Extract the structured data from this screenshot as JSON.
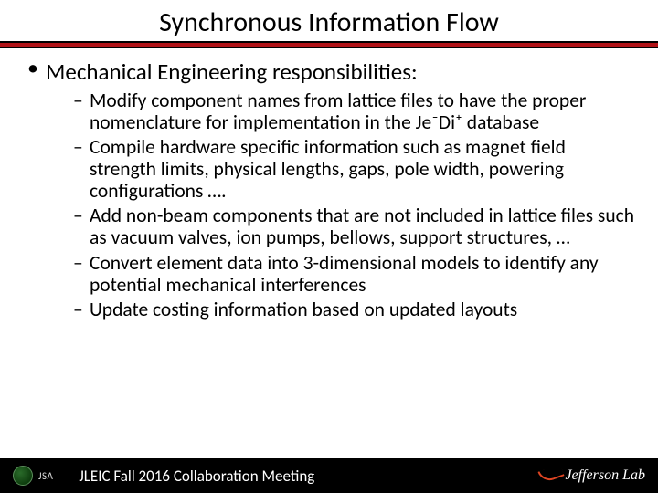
{
  "title": "Synchronous Information Flow",
  "bullet_main": "Mechanical Engineering responsibilities:",
  "sub_bullets": [
    "Modify component names from lattice files to have the proper nomenclature for implementation in the Je⁻Di⁺ database",
    "Compile hardware specific information such as magnet field strength limits, physical lengths, gaps, pole width, powering configurations ….",
    "Add non-beam components that are not included in lattice files such as vacuum valves, ion pumps, bellows, support structures, …",
    "Convert element data into 3-dimensional models to identify any potential mechanical interferences",
    "Update costing information based on updated layouts"
  ],
  "footer": {
    "jsa": "JSA",
    "meeting": "JLEIC Fall 2016 Collaboration Meeting",
    "lab": "Jefferson Lab"
  }
}
